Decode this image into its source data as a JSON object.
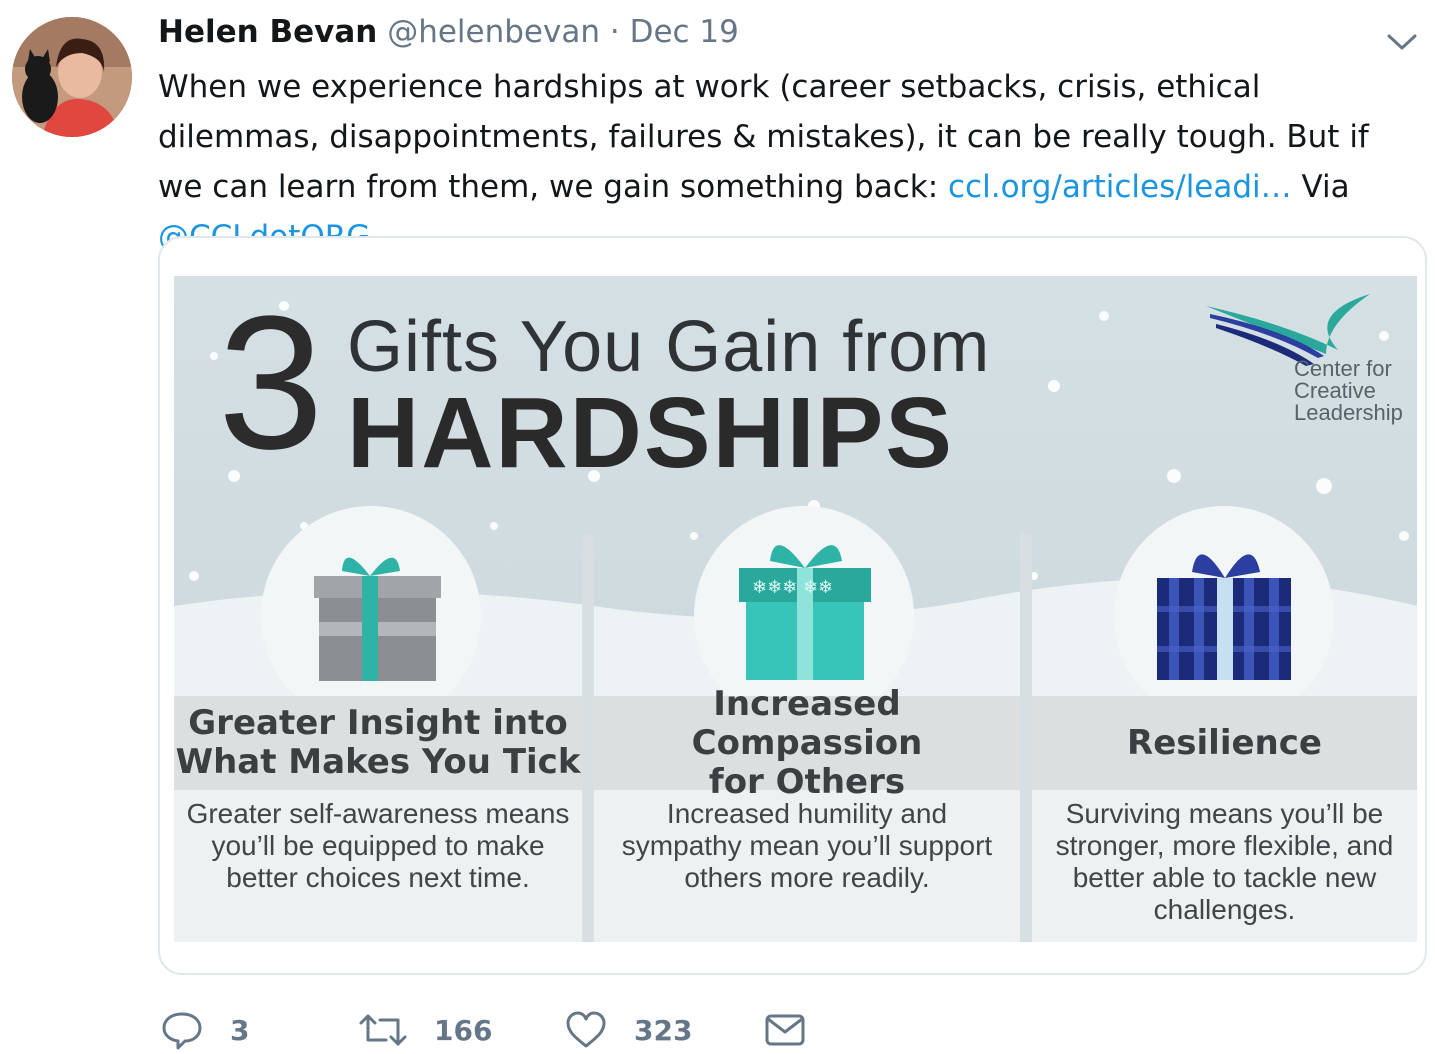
{
  "tweet": {
    "name": "Helen Bevan",
    "handle": "@helenbevan",
    "separator": "·",
    "date": "Dec 19",
    "text_part1": "When we experience hardships at work (career setbacks, crisis, ethical dilemmas, disappointments, failures & mistakes), it can be really tough. But if we can learn from them, we gain something back: ",
    "link_text": "ccl.org/articles/leadi…",
    "text_part2": " Via ",
    "mention": "@CCLdotORG"
  },
  "infographic": {
    "number": "3",
    "title_line1": "Gifts You Gain from",
    "title_line2": "HARDSHIPS",
    "logo_line1": "Center for",
    "logo_line2": "Creative",
    "logo_line3": "Leadership",
    "columns": [
      {
        "title_line1": "Greater Insight into",
        "title_line2": "What Makes You Tick",
        "body": [
          "Greater self-awareness means",
          "you’ll be equipped to make",
          "better choices next time."
        ]
      },
      {
        "title_line1": "Increased Compassion",
        "title_line2": "for Others",
        "body": [
          "Increased humility and",
          "sympathy mean you’ll support",
          "others more readily."
        ]
      },
      {
        "title_line1": "Resilience",
        "title_line2": "",
        "body": [
          "Surviving means you’ll be",
          "stronger, more flexible, and",
          "better able to tackle new",
          "challenges."
        ]
      }
    ]
  },
  "actions": {
    "reply_count": "3",
    "retweet_count": "166",
    "like_count": "323"
  },
  "icons": {
    "reply": "reply-icon",
    "retweet": "retweet-icon",
    "like": "heart-icon",
    "dm": "envelope-icon",
    "caret": "chevron-down-icon"
  },
  "colors": {
    "link": "#1b95e0",
    "muted": "#657786",
    "teal": "#2ab3a6",
    "navy": "#1c2a7a"
  }
}
